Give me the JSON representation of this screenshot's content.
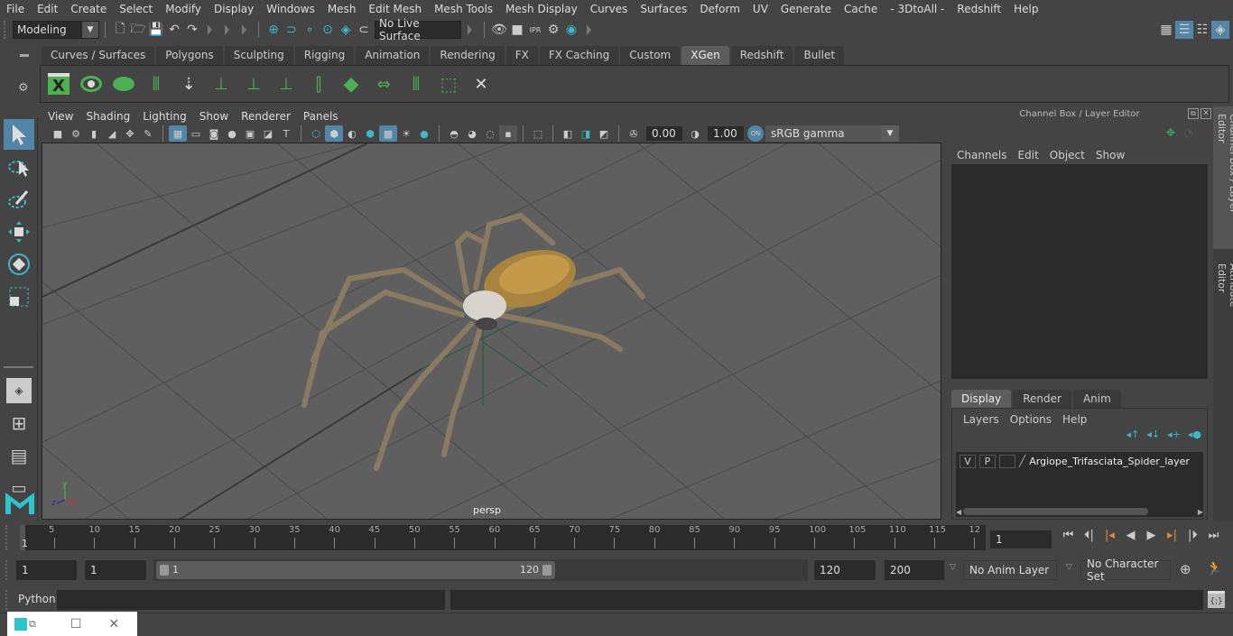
{
  "menubar": {
    "items": [
      "File",
      "Edit",
      "Create",
      "Select",
      "Modify",
      "Display",
      "Windows",
      "Mesh",
      "Edit Mesh",
      "Mesh Tools",
      "Mesh Display",
      "Curves",
      "Surfaces",
      "Deform",
      "UV",
      "Generate",
      "Cache",
      "- 3DtoAll -",
      "Redshift",
      "Help"
    ]
  },
  "statusline": {
    "workspace": "Modeling",
    "live_surface": "No Live Surface"
  },
  "shelf": {
    "tabs": [
      "Curves / Surfaces",
      "Polygons",
      "Sculpting",
      "Rigging",
      "Animation",
      "Rendering",
      "FX",
      "FX Caching",
      "Custom",
      "XGen",
      "Redshift",
      "Bullet"
    ],
    "active_tab": "XGen",
    "icons": [
      "xgen-editor-icon",
      "preview-icon",
      "clear-preview-icon",
      "add-guides-icon",
      "place-guides-icon",
      "add-guide-icon",
      "show-guides-icon",
      "lock-guides-icon",
      "guide-split-icon",
      "sculpt-layer-icon",
      "bend-guides-icon",
      "select-guides-icon",
      "guide-box-icon",
      "delete-guides-icon"
    ]
  },
  "viewport": {
    "menu": [
      "View",
      "Shading",
      "Lighting",
      "Show",
      "Renderer",
      "Panels"
    ],
    "exposure": "0.00",
    "gamma": "1.00",
    "color_management": "ON",
    "color_space": "sRGB gamma",
    "camera_label": "persp",
    "axis_labels": {
      "x": "x",
      "y": "y",
      "z": "z"
    }
  },
  "right_panel": {
    "title": "Channel Box / Layer Editor",
    "channel_menu": [
      "Channels",
      "Edit",
      "Object",
      "Show"
    ],
    "layer_tabs": [
      "Display",
      "Render",
      "Anim"
    ],
    "active_layer_tab": "Display",
    "layer_menu": [
      "Layers",
      "Options",
      "Help"
    ],
    "layers": [
      {
        "v": "V",
        "p": "P",
        "name": "Argiope_Trifasciata_Spider_layer"
      }
    ],
    "side_tabs": [
      "Channel Box / Layer Editor",
      "Attribute Editor"
    ]
  },
  "timeline": {
    "ticks": [
      "5",
      "10",
      "15",
      "20",
      "25",
      "30",
      "35",
      "40",
      "45",
      "50",
      "55",
      "60",
      "65",
      "70",
      "75",
      "80",
      "85",
      "90",
      "95",
      "100",
      "105",
      "110",
      "115",
      "12"
    ],
    "current_frame_marker": "1",
    "current_frame": "1"
  },
  "range": {
    "start": "1",
    "playback_start": "1",
    "slider_start": "1",
    "slider_end": "120",
    "playback_end": "120",
    "end": "200",
    "anim_layer": "No Anim Layer",
    "character_set": "No Character Set"
  },
  "command_line": {
    "language": "Python",
    "input": "",
    "output": ""
  },
  "colors": {
    "accent": "#5285a6",
    "teal": "#3fb6c9",
    "xgen_green": "#4caf50",
    "playhead": "#e08a3c"
  }
}
